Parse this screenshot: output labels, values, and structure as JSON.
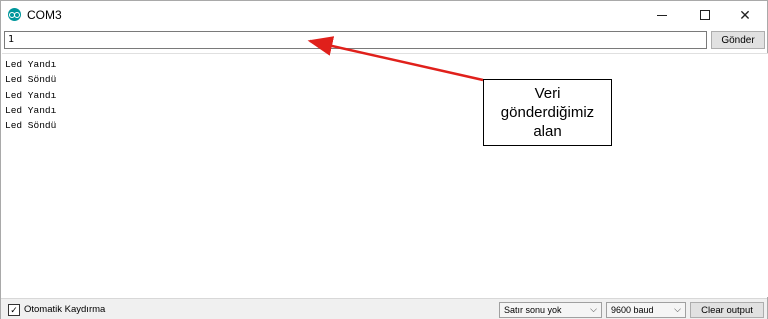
{
  "window": {
    "title": "COM3",
    "icon": "arduino-icon",
    "controls": {
      "minimize": "minimize-icon",
      "maximize": "maximize-icon",
      "close": "close-icon",
      "close_glyph": "✕"
    }
  },
  "send": {
    "input_value": "1",
    "button_label": "Gönder"
  },
  "output": {
    "lines": [
      "Led Yandı",
      "Led Söndü",
      "Led Yandı",
      "Led Yandı",
      "Led Söndü"
    ]
  },
  "annotation": {
    "text_line1": "Veri",
    "text_line2": "gönderdiğimiz",
    "text_line3": "alan",
    "arrow_color": "#e0201b"
  },
  "footer": {
    "autoscroll_checked": true,
    "autoscroll_check_glyph": "✓",
    "autoscroll_label": "Otomatik Kaydırma",
    "line_ending": "Satır sonu yok",
    "baud_rate": "9600 baud",
    "dropdown_glyph": "⌵",
    "clear_label": "Clear output"
  }
}
